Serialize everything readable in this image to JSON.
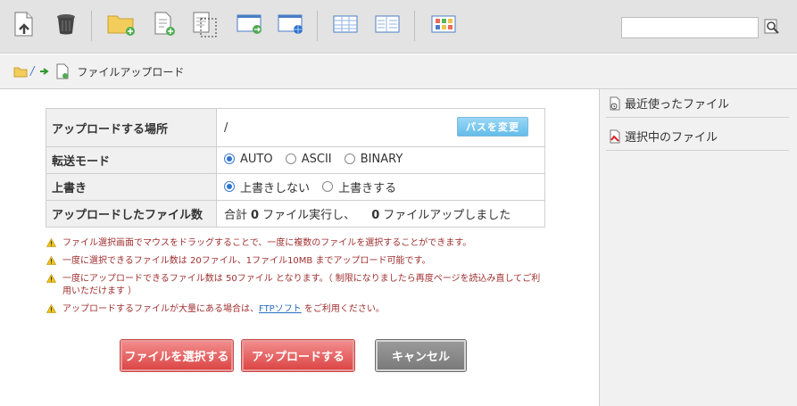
{
  "toolbar": {
    "search": {
      "value": "",
      "placeholder": ""
    }
  },
  "breadcrumb": {
    "root": "/",
    "current": "ファイルアップロード"
  },
  "form": {
    "location_label": "アップロードする場所",
    "location_value": "/",
    "change_path_label": "パスを変更",
    "transfer_label": "転送モード",
    "transfer_options": [
      "AUTO",
      "ASCII",
      "BINARY"
    ],
    "transfer_selected": "AUTO",
    "overwrite_label": "上書き",
    "overwrite_options": [
      "上書きしない",
      "上書きする"
    ],
    "overwrite_selected": "上書きしない",
    "count_label": "アップロードしたファイル数",
    "count_prefix": "合計",
    "executed_count": "0",
    "executed_text": "ファイル実行し、",
    "uploaded_count": "0",
    "uploaded_text": "ファイルアップしました"
  },
  "notes": [
    "ファイル選択画面でマウスをドラッグすることで、一度に複数のファイルを選択することができます。",
    "一度に選択できるファイル数は 20ファイル、1ファイル10MB までアップロード可能です。",
    "一度にアップロードできるファイル数は 50ファイル となります。（ 制限になりましたら再度ページを読込み直してご利用いただけます ）",
    {
      "before": "アップロードするファイルが大量にある場合は、",
      "link": "FTPソフト",
      "after": " をご利用ください。"
    }
  ],
  "actions": {
    "select_label": "ファイルを選択する",
    "upload_label": "アップロードする",
    "cancel_label": "キャンセル"
  },
  "sidebar": {
    "items": [
      {
        "label": "最近使ったファイル"
      },
      {
        "label": "選択中のファイル"
      }
    ]
  },
  "colors": {
    "accent": "#2f73d2",
    "primary_button": "#dc4646",
    "secondary_button": "#7a7a7a",
    "note_text": "#a03030"
  }
}
